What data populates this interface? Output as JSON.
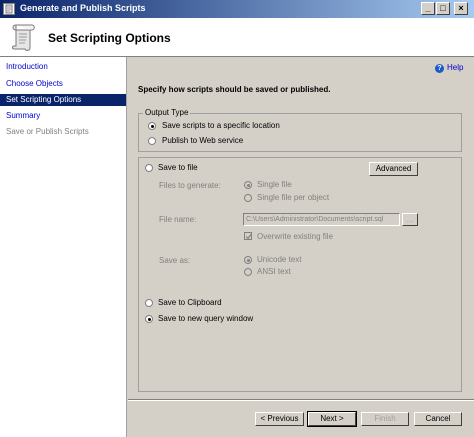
{
  "window": {
    "title": "Generate and Publish Scripts"
  },
  "header": {
    "title": "Set Scripting Options"
  },
  "nav": {
    "items": [
      {
        "label": "Introduction",
        "state": "link"
      },
      {
        "label": "Choose Objects",
        "state": "link"
      },
      {
        "label": "Set Scripting Options",
        "state": "selected"
      },
      {
        "label": "Summary",
        "state": "link"
      },
      {
        "label": "Save or Publish Scripts",
        "state": "disabled"
      }
    ]
  },
  "help": {
    "label": "Help"
  },
  "instructions": "Specify how scripts should be saved or published.",
  "output_type": {
    "legend": "Output Type",
    "save_scripts": "Save scripts to a specific location",
    "publish_web": "Publish to Web service",
    "selected": "save_scripts"
  },
  "save_to_file": {
    "label": "Save to file",
    "advanced_label": "Advanced",
    "files_to_generate_label": "Files to generate:",
    "single_file": "Single file",
    "single_file_per_object": "Single file per object",
    "file_name_label": "File name:",
    "file_name_value": "C:\\Users\\Administrator\\Documents\\script.sql",
    "browse_label": "...",
    "overwrite_label": "Overwrite existing file",
    "save_as_label": "Save as:",
    "unicode_text": "Unicode text",
    "ansi_text": "ANSI text"
  },
  "save_to_clipboard": {
    "label": "Save to Clipboard"
  },
  "save_to_query": {
    "label": "Save to new query window"
  },
  "footer": {
    "previous": "< Previous",
    "next": "Next >",
    "finish": "Finish",
    "cancel": "Cancel"
  },
  "colors": {
    "title_start": "#0a246a",
    "title_end": "#a6caf0",
    "selected_nav": "#0a246a",
    "link": "#0000cc"
  }
}
